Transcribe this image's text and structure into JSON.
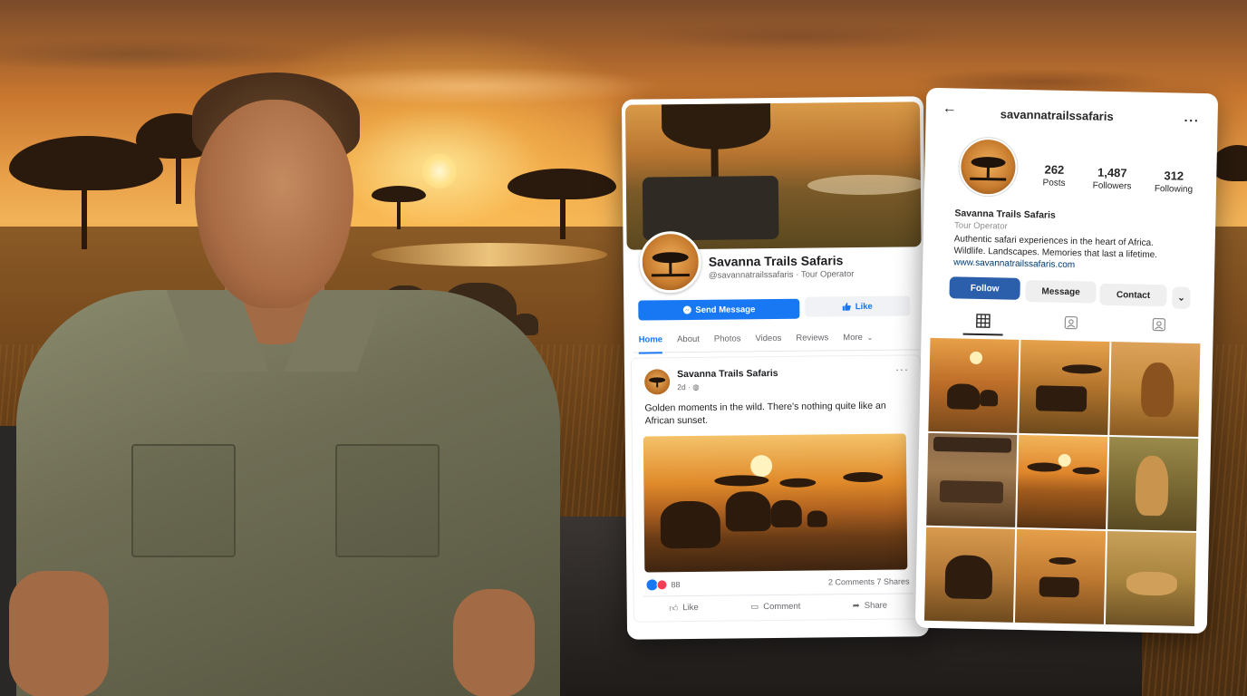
{
  "facebook": {
    "page_name": "Savanna Trails Safaris",
    "handle_line": "@savannatrailssafaris · Tour Operator",
    "send_message_label": "Send Message",
    "like_label": "Like",
    "tabs": [
      {
        "label": "Home",
        "active": true
      },
      {
        "label": "About",
        "active": false
      },
      {
        "label": "Photos",
        "active": false
      },
      {
        "label": "Videos",
        "active": false
      },
      {
        "label": "Reviews",
        "active": false
      },
      {
        "label": "More",
        "active": false
      }
    ],
    "post": {
      "author": "Savanna Trails Safaris",
      "time": "2d ·",
      "text": "Golden moments in the wild. There's nothing quite like an African sunset.",
      "reaction_count": "88",
      "comments_shares": "2 Comments  7 Shares",
      "actions": {
        "like": "Like",
        "comment": "Comment",
        "share": "Share"
      }
    }
  },
  "instagram": {
    "username": "savannatrailssafaris",
    "stats": [
      {
        "value": "262",
        "label": "Posts"
      },
      {
        "value": "1,487",
        "label": "Followers"
      },
      {
        "value": "312",
        "label": "Following"
      }
    ],
    "bio_name": "Savanna Trails Safaris",
    "bio_category": "Tour Operator",
    "bio_text": "Authentic safari experiences in the heart of Africa. Wildlife. Landscapes. Memories that last a lifetime.",
    "bio_link": "www.savannatrailssafaris.com",
    "buttons": {
      "follow": "Follow",
      "message": "Message",
      "contact": "Contact"
    },
    "tabs": [
      "grid-icon",
      "reels-icon",
      "tagged-icon"
    ]
  },
  "colors": {
    "facebook_blue": "#1877f2",
    "instagram_follow": "#2c5fab",
    "sunset_orange": "#e08a2a"
  }
}
